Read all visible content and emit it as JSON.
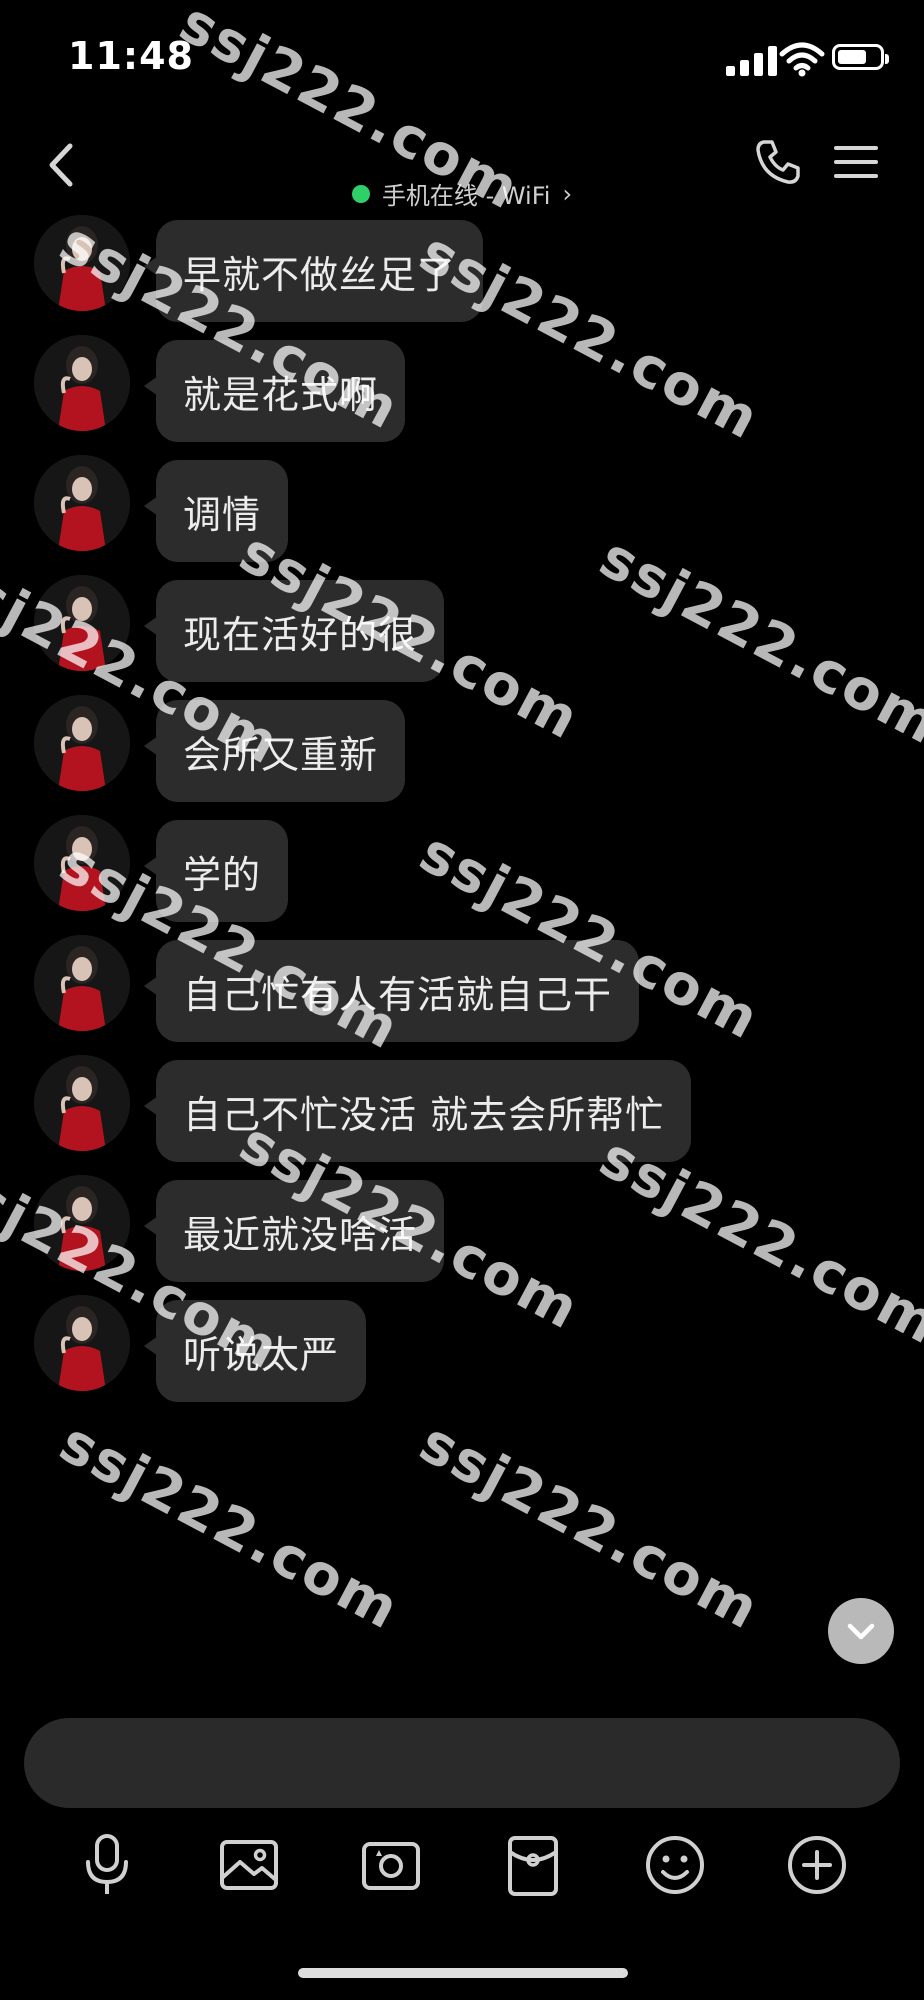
{
  "status_bar": {
    "time": "11:48",
    "battery_level": 0.7
  },
  "header": {
    "contact_name": "",
    "presence": "手机在线 - WiFi",
    "presence_chevron": "›",
    "status_color": "#2fd06a"
  },
  "messages": [
    {
      "sender": "contact",
      "text": "早就不做丝足了"
    },
    {
      "sender": "contact",
      "text": "就是花式啊"
    },
    {
      "sender": "contact",
      "text": "调情"
    },
    {
      "sender": "contact",
      "text": "现在活好的很"
    },
    {
      "sender": "contact",
      "text": "会所又重新"
    },
    {
      "sender": "contact",
      "text": "学的"
    },
    {
      "sender": "contact",
      "text": "自己忙有人有活就自己干"
    },
    {
      "sender": "contact",
      "text": "自己不忙没活 就去会所帮忙"
    },
    {
      "sender": "contact",
      "text": "最近就没啥活"
    },
    {
      "sender": "contact",
      "text": "听说太严"
    }
  ],
  "input": {
    "value": "",
    "placeholder": ""
  },
  "toolbar": [
    "microphone-icon",
    "image-icon",
    "camera-icon",
    "red-packet-icon",
    "emoji-icon",
    "plus-icon"
  ],
  "watermark": {
    "text": "ssj222.com"
  },
  "colors": {
    "background": "#000000",
    "bubble": "#2c2c2c",
    "accent_online": "#2fd06a",
    "avatar_dress": "#b3131f"
  }
}
